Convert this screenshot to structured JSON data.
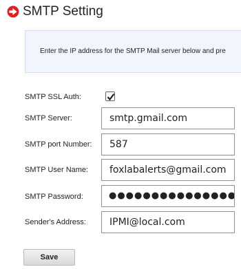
{
  "page": {
    "title": "SMTP Setting"
  },
  "info": {
    "text": "Enter the IP address for the SMTP Mail server below and pre"
  },
  "form": {
    "ssl_auth": {
      "label": "SMTP SSL Auth:",
      "checked": true
    },
    "server": {
      "label": "SMTP Server:",
      "value": "smtp.gmail.com"
    },
    "port": {
      "label": "SMTP port Number:",
      "value": "587"
    },
    "username": {
      "label": "SMTP User Name:",
      "value": "foxlabalerts@gmail.com"
    },
    "password": {
      "label": "SMTP Password:",
      "value": "●●●●●●●●●●●●●●●●●●"
    },
    "sender": {
      "label": "Sender's Address:",
      "value": "IPMI@local.com"
    }
  },
  "actions": {
    "save_label": "Save"
  },
  "colors": {
    "accent_red": "#e02020",
    "info_bg": "#f1f5fd"
  },
  "icons": {
    "title_icon": "arrow-circle-right-icon",
    "checkbox": "check-icon"
  }
}
